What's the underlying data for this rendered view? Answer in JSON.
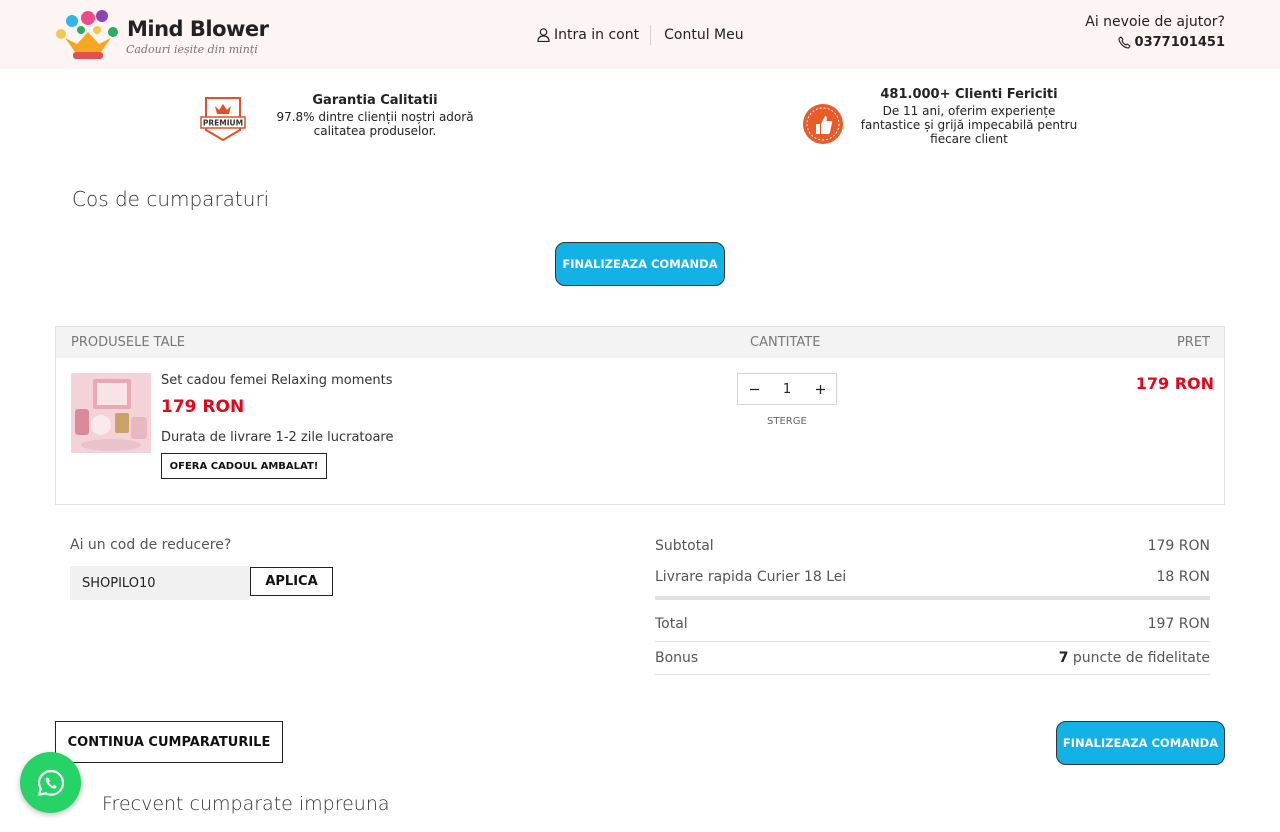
{
  "brand": {
    "name": "Mind Blower",
    "tagline": "Cadouri ieșite din minți"
  },
  "nav": {
    "login_label": "Intra in cont",
    "account_label": "Contul Meu"
  },
  "help": {
    "title": "Ai nevoie de ajutor?",
    "phone": "0377101451"
  },
  "trust": {
    "quality": {
      "badge_text": "PREMIUM",
      "title": "Garantia Calitatii",
      "text": "97.8% dintre clienții noștri adoră calitatea produselor."
    },
    "clients": {
      "title": "481.000+ Clienti Fericiti",
      "text": "De 11 ani, oferim experiențe fantastice și grijă impecabilă pentru fiecare client"
    }
  },
  "cart": {
    "title": "Cos de cumparaturi",
    "checkout_label": "FINALIZEAZA COMANDA",
    "headers": {
      "products": "PRODUSELE TALE",
      "quantity": "CANTITATE",
      "price": "PRET"
    },
    "items": [
      {
        "name": "Set cadou femei Relaxing moments",
        "price": "179 RON",
        "delivery": "Durata de livrare 1-2 zile lucratoare",
        "gift_label": "OFERA CADOUL AMBALAT!",
        "quantity": "1",
        "remove_label": "STERGE",
        "line_total": "179 RON"
      }
    ]
  },
  "discount": {
    "label": "Ai un cod de reducere?",
    "value": "SHOPILO10",
    "apply_label": "APLICA"
  },
  "totals": {
    "subtotal_label": "Subtotal",
    "subtotal_value": "179 RON",
    "shipping_label": "Livrare rapida Curier 18 Lei",
    "shipping_value": "18 RON",
    "total_label": "Total",
    "total_value": "197 RON",
    "bonus_label": "Bonus",
    "bonus_points": "7",
    "bonus_suffix": " puncte de fidelitate"
  },
  "actions": {
    "continue_label": "CONTINUA CUMPARATURILE",
    "checkout_label": "FINALIZEAZA COMANDA"
  },
  "recommend": {
    "title": "Frecvent cumparate impreuna"
  },
  "colors": {
    "accent": "#12b2e6",
    "price": "#e0091b",
    "header_bg": "#fdf5f3",
    "whatsapp": "#25d366"
  },
  "icons": {
    "login": "user-icon",
    "phone": "phone-icon",
    "whatsapp": "whatsapp-icon"
  }
}
